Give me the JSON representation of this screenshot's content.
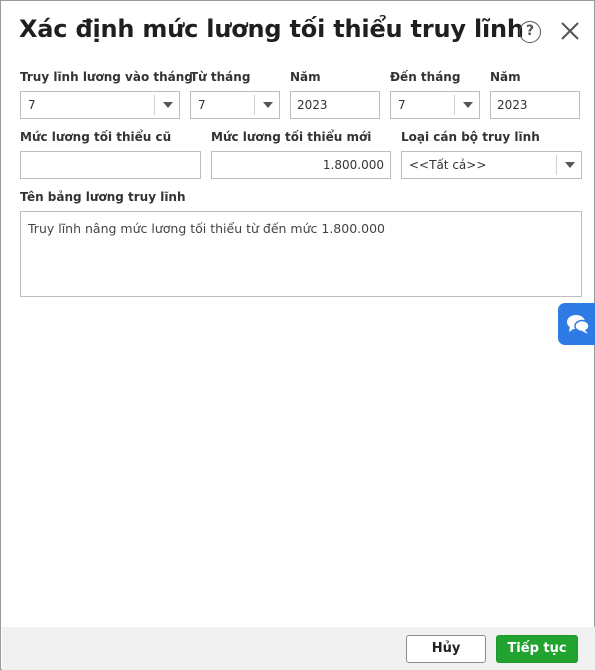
{
  "dialog": {
    "title": "Xác định mức lương tối thiểu truy lĩnh",
    "help_icon": "question-circle-icon",
    "close_icon": "close-x-icon"
  },
  "row1": {
    "month_label": "Truy lĩnh lương vào tháng",
    "month_value": "7",
    "from_month_label": "Từ tháng",
    "from_month_value": "7",
    "from_year_label": "Năm",
    "from_year_value": "2023",
    "to_month_label": "Đến tháng",
    "to_month_value": "7",
    "to_year_label": "Năm",
    "to_year_value": "2023"
  },
  "row2": {
    "old_min_label": "Mức lương tối thiểu cũ",
    "old_min_value": "",
    "new_min_label": "Mức lương tối thiểu mới",
    "new_min_value": "1.800.000",
    "staff_type_label": "Loại cán bộ truy lĩnh",
    "staff_type_value": "<<Tất cả>>"
  },
  "table_name": {
    "label": "Tên bảng lương truy lĩnh",
    "value": "Truy lĩnh nâng mức lương tối thiểu từ  đến mức 1.800.000"
  },
  "footer": {
    "cancel_label": "Hủy",
    "next_label": "Tiếp tục"
  },
  "chat_widget": {
    "icon": "chat-bubbles-icon"
  },
  "colors": {
    "primary_button": "#21a32f",
    "chat_widget": "#2e7be6",
    "footer_bg": "#f1f1f1"
  }
}
